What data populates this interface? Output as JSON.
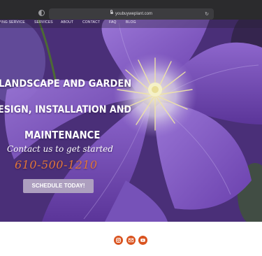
{
  "browser": {
    "address": "youbuyweplant.com",
    "icons": [
      "privacy-icon",
      "lock-icon",
      "reload-icon"
    ]
  },
  "nav": {
    "items": [
      {
        "key": "landscaping",
        "label": "PING SERVICE"
      },
      {
        "key": "services",
        "label": "SERVICES"
      },
      {
        "key": "about",
        "label": "ABOUT"
      },
      {
        "key": "contact",
        "label": "CONTACT"
      },
      {
        "key": "faq",
        "label": "FAQ"
      },
      {
        "key": "blog",
        "label": "BLOG"
      }
    ]
  },
  "hero": {
    "headline_line1": "LANDSCAPE AND GARDEN",
    "headline_line2": "ESIGN, INSTALLATION AND",
    "headline_line3": "MAINTENANCE",
    "cta_text": "Contact us to get started",
    "phone": "610-500-1210",
    "button_label": "SCHEDULE TODAY!",
    "image": "purple clematis flower"
  },
  "footer": {
    "social": [
      {
        "key": "instagram",
        "icon": "instagram-icon"
      },
      {
        "key": "email",
        "icon": "email-icon"
      },
      {
        "key": "youtube",
        "icon": "youtube-icon"
      }
    ],
    "icon_color": "#d9531f"
  },
  "colors": {
    "browser_bar": "#2b2b2d",
    "petal": "#7b52bb",
    "phone": "#e0763a",
    "button": "#ad9fbf"
  }
}
